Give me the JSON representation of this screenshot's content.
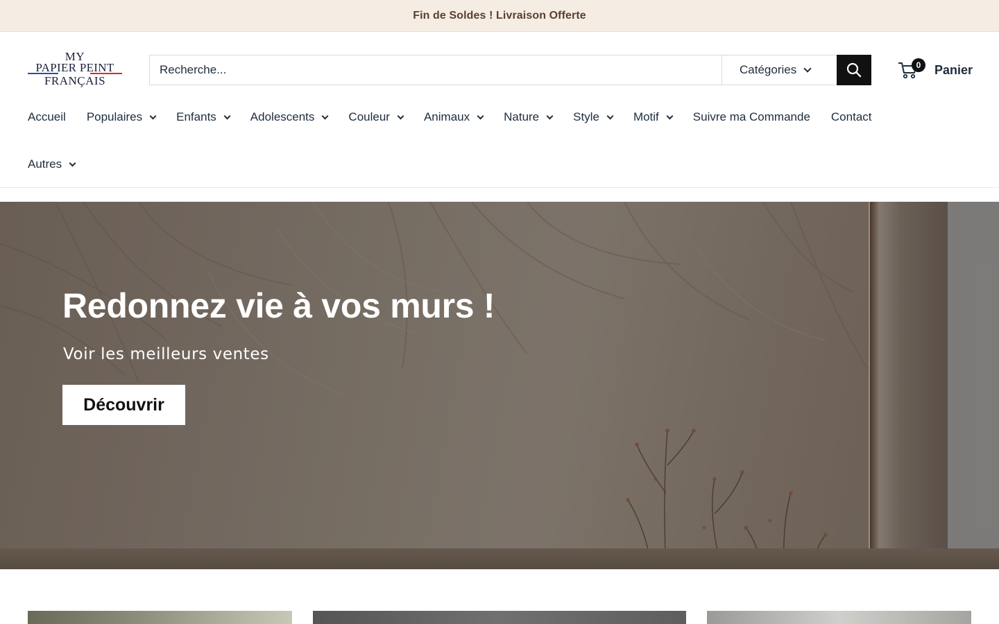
{
  "announcement": {
    "text": "Fin de Soldes ! Livraison Offerte"
  },
  "logo": {
    "line1": "MY",
    "line2": "PAPIER PEINT",
    "line3": "FRANÇAIS"
  },
  "search": {
    "placeholder": "Recherche...",
    "category_label": "Catégories"
  },
  "cart": {
    "count": "0",
    "label": "Panier"
  },
  "nav": {
    "row1": [
      {
        "label": "Accueil",
        "has_dropdown": false
      },
      {
        "label": "Populaires",
        "has_dropdown": true
      },
      {
        "label": "Enfants",
        "has_dropdown": true
      },
      {
        "label": "Adolescents",
        "has_dropdown": true
      },
      {
        "label": "Couleur",
        "has_dropdown": true
      },
      {
        "label": "Animaux",
        "has_dropdown": true
      },
      {
        "label": "Nature",
        "has_dropdown": true
      },
      {
        "label": "Style",
        "has_dropdown": true
      },
      {
        "label": "Motif",
        "has_dropdown": true
      },
      {
        "label": "Suivre ma Commande",
        "has_dropdown": false
      },
      {
        "label": "Contact",
        "has_dropdown": false
      }
    ],
    "row2": [
      {
        "label": "Autres",
        "has_dropdown": true
      }
    ]
  },
  "hero": {
    "title": "Redonnez vie à vos murs !",
    "subtitle": "Voir les meilleurs ventes",
    "button_label": "Découvrir"
  },
  "colors": {
    "announcement_bg": "#f5ede4",
    "announcement_text": "#5a4030",
    "primary_text": "#1e2d3d",
    "search_button_bg": "#111111"
  }
}
